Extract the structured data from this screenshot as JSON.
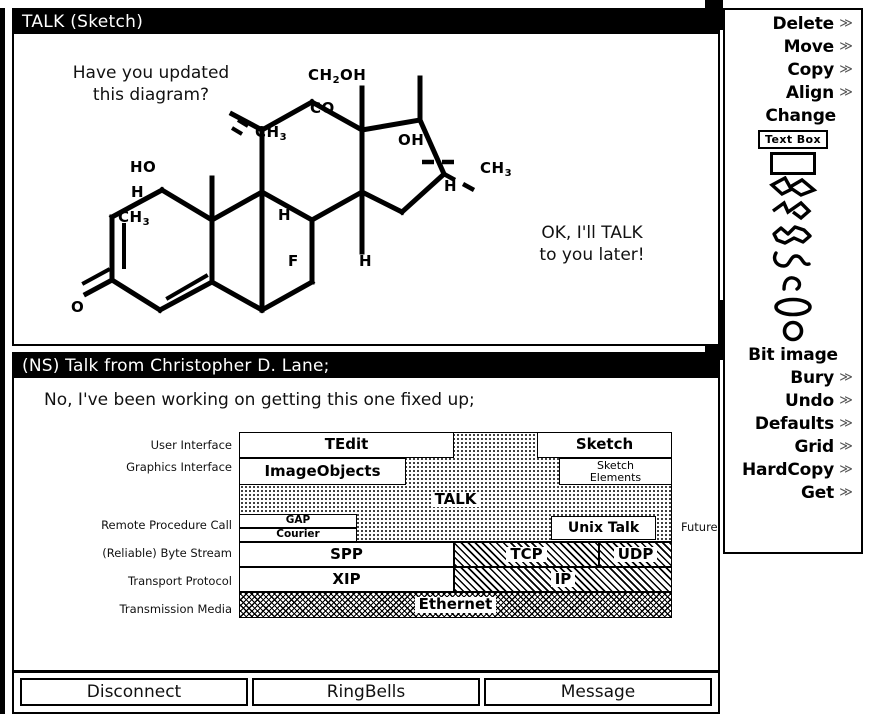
{
  "sketch_window": {
    "title": "TALK (Sketch)",
    "note_updated": "Have you updated\nthis diagram?",
    "note_later": "OK, I'll TALK\nto you later!",
    "molecule": {
      "name": "dexamethasone-structure",
      "labels": [
        "CH2OH",
        "CO",
        "OH",
        "CH3",
        "CH3",
        "CH3",
        "HO",
        "H",
        "H",
        "H",
        "H",
        "F",
        "O"
      ]
    }
  },
  "talk_window": {
    "title": "(NS) Talk from Christopher D. Lane;",
    "message": "No, I've been working on getting this one fixed up;",
    "buttons": [
      {
        "label": "Disconnect"
      },
      {
        "label": "RingBells"
      },
      {
        "label": "Message"
      }
    ]
  },
  "stack_diagram": {
    "row_labels": [
      "User Interface",
      "Graphics Interface",
      "Remote Procedure Call",
      "(Reliable) Byte Stream",
      "Transport Protocol",
      "Transmission Media"
    ],
    "boxes": {
      "tedit": "TEdit",
      "sketch": "Sketch",
      "imageobjects": "ImageObjects",
      "sketch_elements": "Sketch\nElements",
      "talk": "TALK",
      "gap": "GAP",
      "courier": "Courier",
      "unix_talk": "Unix Talk",
      "spp": "SPP",
      "tcp": "TCP",
      "udp": "UDP",
      "xip": "XIP",
      "ip": "IP",
      "ethernet": "Ethernet"
    },
    "annotation_future": "Future"
  },
  "tool_menu": {
    "items": [
      {
        "label": "Delete",
        "arrow": "≫",
        "has_arrow": true
      },
      {
        "label": "Move",
        "arrow": "≫",
        "has_arrow": true
      },
      {
        "label": "Copy",
        "arrow": "≫",
        "has_arrow": true
      },
      {
        "label": "Align",
        "arrow": "≫",
        "has_arrow": true
      },
      {
        "label": "Change",
        "arrow": "",
        "has_arrow": false
      }
    ],
    "textbox_chip": "Text Box",
    "shape_tools": [
      "rectangle-tool",
      "arrow-polyline-tool",
      "open-polygon-tool",
      "closed-polygon-tool",
      "curve-tool",
      "arc-tool",
      "ellipse-tool",
      "circle-tool"
    ],
    "items_lower": [
      {
        "label": "Bit image",
        "arrow": "",
        "has_arrow": false
      },
      {
        "label": "Bury",
        "arrow": "≫",
        "has_arrow": true
      },
      {
        "label": "Undo",
        "arrow": "≫",
        "has_arrow": true
      },
      {
        "label": "Defaults",
        "arrow": "≫",
        "has_arrow": true
      },
      {
        "label": "Grid",
        "arrow": "≫",
        "has_arrow": true
      },
      {
        "label": "HardCopy",
        "arrow": "≫",
        "has_arrow": true
      },
      {
        "label": "Get",
        "arrow": "≫",
        "has_arrow": true
      }
    ]
  },
  "colors": {
    "ink": "#000000",
    "paper": "#ffffff",
    "titlebar_bg": "#000000",
    "titlebar_fg": "#ffffff"
  }
}
